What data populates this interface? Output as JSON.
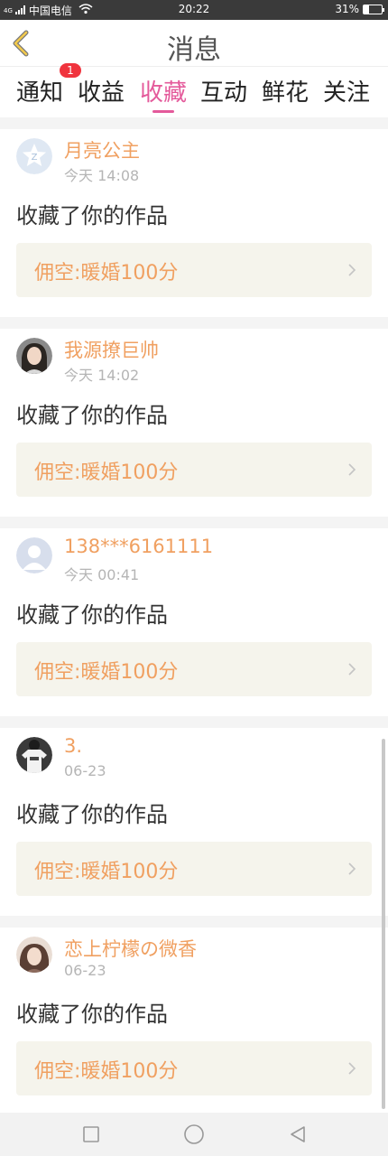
{
  "status": {
    "carrier": "中国电信",
    "network": "4G",
    "time": "20:22",
    "battery": "31%",
    "battery_level": 0.31
  },
  "header": {
    "title": "消息"
  },
  "tabs": [
    {
      "label": "通知",
      "badge": "1"
    },
    {
      "label": "收益"
    },
    {
      "label": "收藏",
      "active": true
    },
    {
      "label": "互动"
    },
    {
      "label": "鲜花"
    },
    {
      "label": "关注"
    }
  ],
  "items": [
    {
      "user": "月亮公主",
      "time": "今天 14:08",
      "action": "收藏了你的作品",
      "work": "佣空:暖婚100分",
      "avatar": "default-star-avatar"
    },
    {
      "user": "我源撩巨帅",
      "time": "今天 14:02",
      "action": "收藏了你的作品",
      "work": "佣空:暖婚100分",
      "avatar": "girl-photo-avatar"
    },
    {
      "user": "138***6161111",
      "time": "今天 00:41",
      "action": "收藏了你的作品",
      "work": "佣空:暖婚100分",
      "avatar": "default-person-avatar"
    },
    {
      "user": "3.",
      "time": "06-23",
      "action": "收藏了你的作品",
      "work": "佣空:暖婚100分",
      "avatar": "tshirt-photo-avatar"
    },
    {
      "user": "恋上柠檬の微香",
      "time": "06-23",
      "action": "收藏了你的作品",
      "work": "佣空:暖婚100分",
      "avatar": "girl2-photo-avatar"
    }
  ],
  "colors": {
    "accent": "#e45a9b",
    "username": "#f0a061",
    "badge": "#f0343e",
    "work_bg": "#f5f4ec"
  }
}
